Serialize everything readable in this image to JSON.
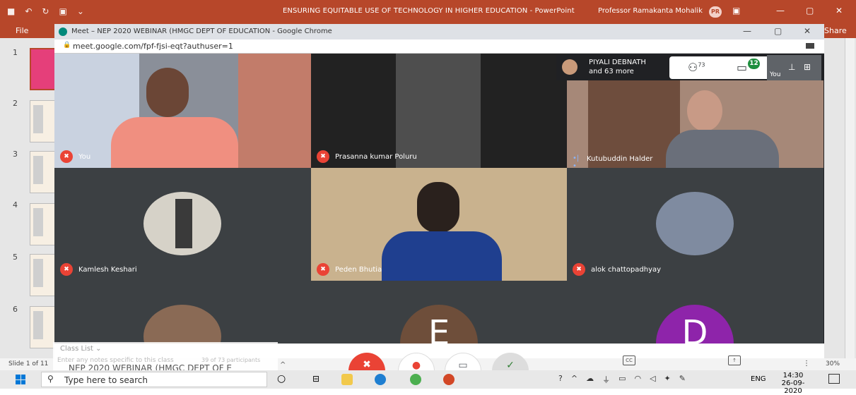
{
  "ppt": {
    "doc_title": "ENSURING EQUITABLE USE OF TECHNOLOGY IN HIGHER EDUCATION  -  PowerPoint",
    "user": "Professor Ramakanta Mohalik",
    "initials": "PR",
    "file_label": "File",
    "share_label": "Share",
    "slide_numbers": [
      "1",
      "2",
      "3",
      "4",
      "5",
      "6"
    ],
    "status_slide": "Slide 1 of 11",
    "zoom": "30%"
  },
  "chrome": {
    "title": "Meet – NEP 2020 WEBINAR (HMGC DEPT OF EDUCATION - Google Chrome",
    "url": "meet.google.com/fpf-fjsi-eqt?authuser=1"
  },
  "meet": {
    "top_name": "PIYALI DEBNATH",
    "top_more": "and 63 more",
    "participant_count": "73",
    "chat_badge": "12",
    "self_label": "You",
    "tiles": [
      {
        "name": "You"
      },
      {
        "name": "Prasanna kumar Poluru"
      },
      {
        "name": "Kutubuddin Halder"
      },
      {
        "name": "Kamlesh Keshari"
      },
      {
        "name": "Peden Bhutia"
      },
      {
        "name": "alok chattopadhyay"
      }
    ],
    "letter_e": "E",
    "letter_d": "D"
  },
  "classlist": {
    "label": "Class List ⌄",
    "notes": "Enter any notes specific to this class",
    "count": "39 of 73 participants",
    "sub": "NEP 2020 WEBINAR (HMGC DEPT OF E"
  },
  "taskbar": {
    "search_placeholder": "Type here to search",
    "lang": "ENG",
    "time": "14:30",
    "date": "26-09-2020"
  }
}
